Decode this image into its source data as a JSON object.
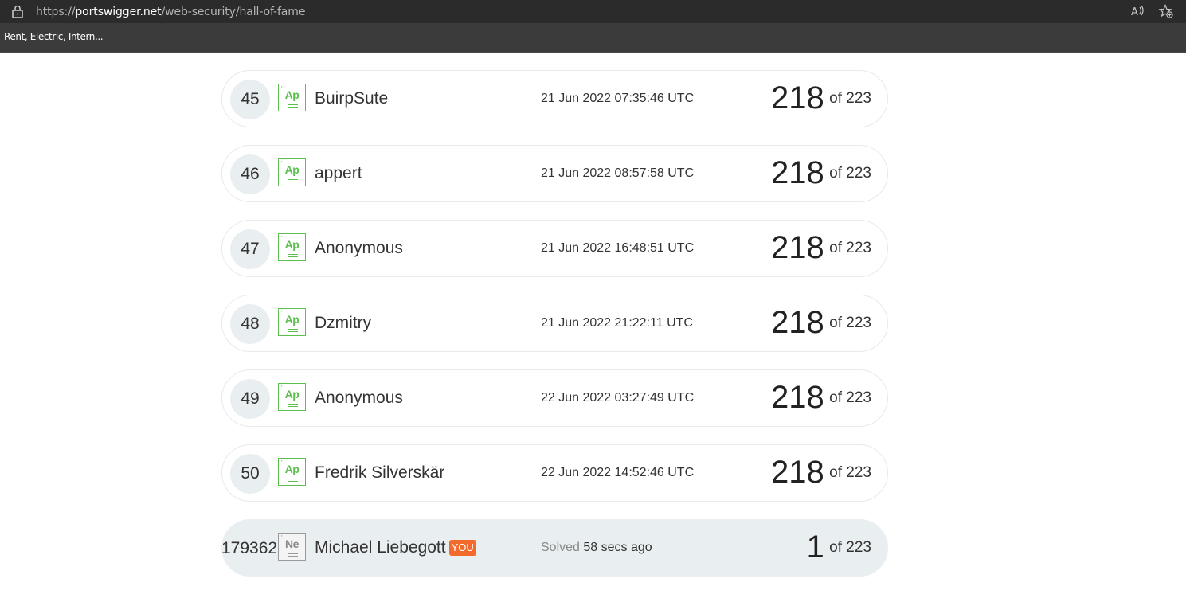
{
  "browser": {
    "url_prefix": "https://",
    "url_domain": "portswigger.net",
    "url_path": "/web-security/hall-of-fame",
    "bookmark": "Rent, Electric, Intern..."
  },
  "rows": [
    {
      "rank": "45",
      "badge": "Ap",
      "name": "BuirpSute",
      "date": "21 Jun 2022 07:35:46 UTC",
      "score": "218",
      "of": "of 223"
    },
    {
      "rank": "46",
      "badge": "Ap",
      "name": "appert",
      "date": "21 Jun 2022 08:57:58 UTC",
      "score": "218",
      "of": "of 223"
    },
    {
      "rank": "47",
      "badge": "Ap",
      "name": "Anonymous",
      "date": "21 Jun 2022 16:48:51 UTC",
      "score": "218",
      "of": "of 223"
    },
    {
      "rank": "48",
      "badge": "Ap",
      "name": "Dzmitry",
      "date": "21 Jun 2022 21:22:11 UTC",
      "score": "218",
      "of": "of 223"
    },
    {
      "rank": "49",
      "badge": "Ap",
      "name": "Anonymous",
      "date": "22 Jun 2022 03:27:49 UTC",
      "score": "218",
      "of": "of 223"
    },
    {
      "rank": "50",
      "badge": "Ap",
      "name": "Fredrik Silverskär",
      "date": "22 Jun 2022 14:52:46 UTC",
      "score": "218",
      "of": "of 223"
    }
  ],
  "you_row": {
    "rank": "179362",
    "badge": "Ne",
    "name": "Michael Liebegott",
    "tag": "YOU",
    "solved_label": "Solved",
    "solved_time": "58 secs ago",
    "score": "1",
    "of": "of 223"
  },
  "colors": {
    "badge_green": "#5cc04f",
    "you_tag": "#f26a2c",
    "row_highlight": "#e9eef0"
  }
}
